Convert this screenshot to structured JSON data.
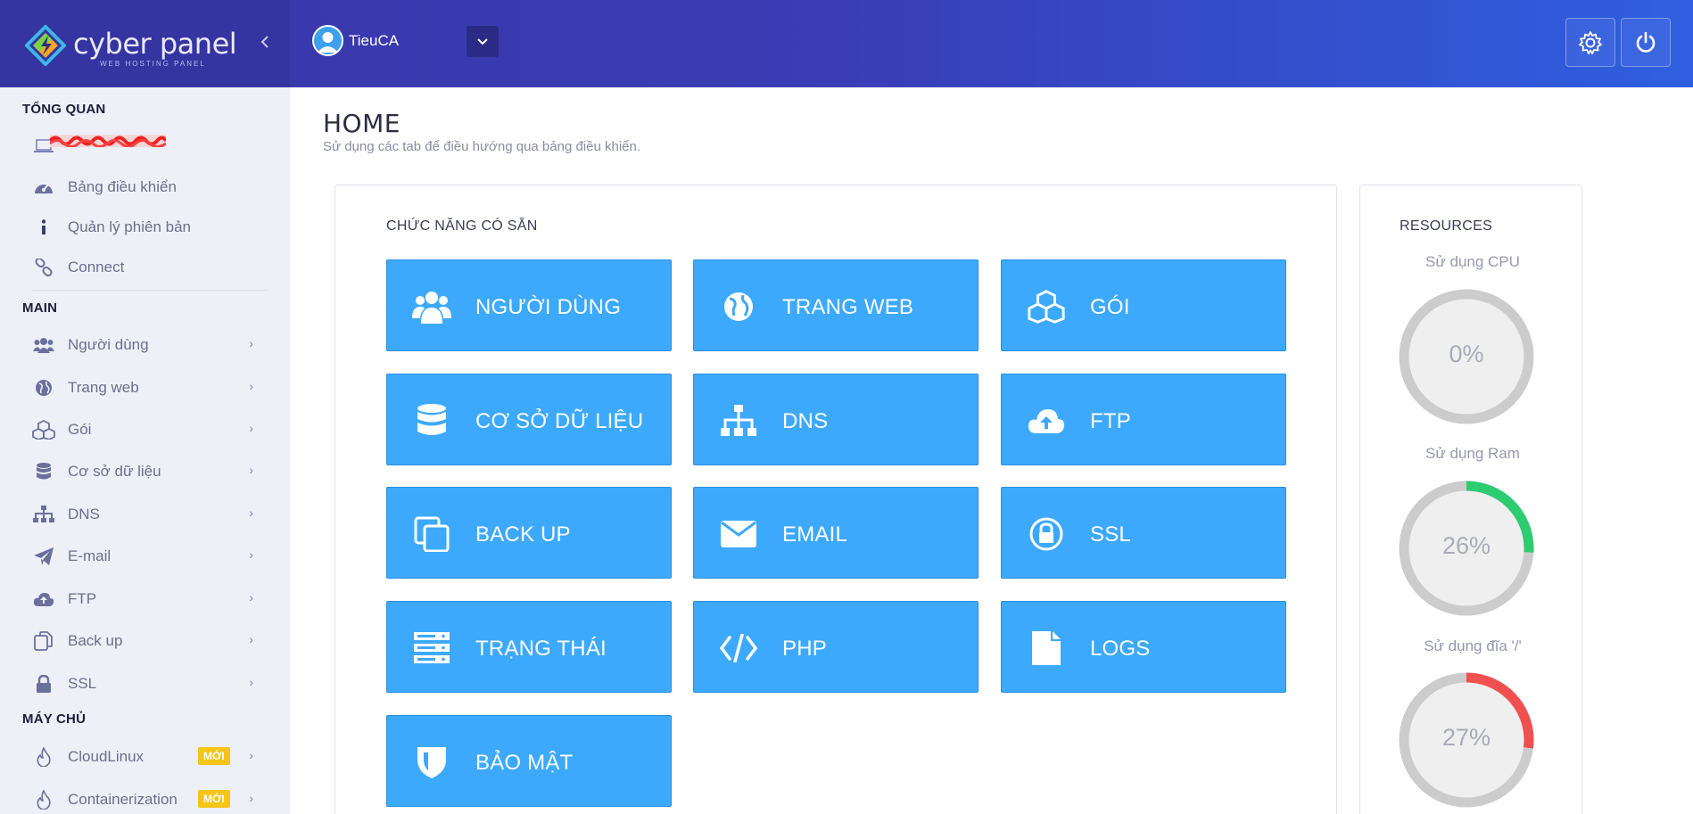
{
  "brand": {
    "name": "cyber panel",
    "tagline": "WEB HOSTING PANEL"
  },
  "header": {
    "username": "TieuCA",
    "collapse_icon": "chevron-left-icon",
    "settings_icon": "gear-icon",
    "power_icon": "power-icon"
  },
  "sidebar": {
    "sections": {
      "overview": "TỔNG QUAN",
      "main": "MAIN",
      "server": "MÁY CHỦ"
    },
    "overview_items": [
      {
        "label": "Bảng điều khiển",
        "icon": "dashboard-icon"
      },
      {
        "label": "Quản lý phiên bản",
        "icon": "info-icon"
      },
      {
        "label": "Connect",
        "icon": "link-icon"
      }
    ],
    "main_items": [
      {
        "label": "Người dùng",
        "icon": "users-icon"
      },
      {
        "label": "Trang web",
        "icon": "globe-icon"
      },
      {
        "label": "Gói",
        "icon": "cubes-icon"
      },
      {
        "label": "Cơ sở dữ liệu",
        "icon": "database-icon"
      },
      {
        "label": "DNS",
        "icon": "sitemap-icon"
      },
      {
        "label": "E-mail",
        "icon": "paper-plane-icon"
      },
      {
        "label": "FTP",
        "icon": "cloud-upload-icon"
      },
      {
        "label": "Back up",
        "icon": "copy-icon"
      },
      {
        "label": "SSL",
        "icon": "lock-icon"
      }
    ],
    "server_items": [
      {
        "label": "CloudLinux",
        "icon": "fire-icon",
        "badge": "MỚI"
      },
      {
        "label": "Containerization",
        "icon": "fire-icon",
        "badge": "MỚI"
      }
    ]
  },
  "main": {
    "title": "HOME",
    "subtitle": "Sử dụng các tab để điều hướng qua bảng điều khiển.",
    "features_title": "CHỨC NĂNG CÓ SẴN",
    "tiles": [
      {
        "label": "NGƯỜI DÙNG",
        "icon": "users-icon"
      },
      {
        "label": "TRANG WEB",
        "icon": "globe-icon"
      },
      {
        "label": "GÓI",
        "icon": "cubes-icon"
      },
      {
        "label": "CƠ SỞ DỮ LIỆU",
        "icon": "database-icon"
      },
      {
        "label": "DNS",
        "icon": "sitemap-icon"
      },
      {
        "label": "FTP",
        "icon": "cloud-upload-icon"
      },
      {
        "label": "BACK UP",
        "icon": "copy-icon"
      },
      {
        "label": "EMAIL",
        "icon": "envelope-icon"
      },
      {
        "label": "SSL",
        "icon": "lock-icon"
      },
      {
        "label": "TRẠNG THÁI",
        "icon": "server-icon"
      },
      {
        "label": "PHP",
        "icon": "code-icon"
      },
      {
        "label": "LOGS",
        "icon": "file-icon"
      },
      {
        "label": "BẢO MẬT",
        "icon": "shield-icon"
      }
    ]
  },
  "resources": {
    "title": "RESOURCES",
    "cpu": {
      "label": "Sử dụng CPU",
      "value": "0%",
      "percent": 0,
      "color": "#cccccc"
    },
    "ram": {
      "label": "Sử dụng Ram",
      "value": "26%",
      "percent": 26,
      "color": "#2ecc71"
    },
    "disk": {
      "label": "Sử dụng đĩa '/'",
      "value": "27%",
      "percent": 27,
      "color": "#f0504f"
    }
  },
  "colors": {
    "tile": "#3da9fc",
    "header_start": "#3b36a8",
    "header_end": "#2f5fe0",
    "sidebar_bg": "#eef0f8",
    "badge": "#f5c518"
  }
}
